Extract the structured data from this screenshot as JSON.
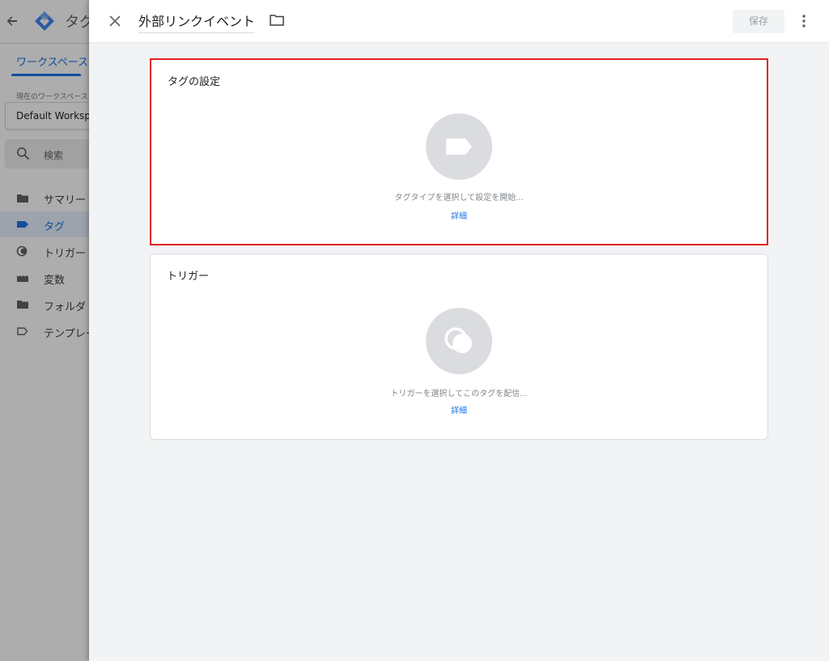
{
  "background": {
    "title": "タグ",
    "workspace_tab": "ワークスペース",
    "workspace_label": "現在のワークスペース",
    "workspace_name": "Default Workspace",
    "search_placeholder": "検索",
    "nav": [
      {
        "label": "サマリー",
        "icon": "summary-icon"
      },
      {
        "label": "タグ",
        "icon": "tag-icon"
      },
      {
        "label": "トリガー",
        "icon": "trigger-icon"
      },
      {
        "label": "変数",
        "icon": "variables-icon"
      },
      {
        "label": "フォルダ",
        "icon": "folder-icon"
      },
      {
        "label": "テンプレート",
        "icon": "template-icon"
      }
    ],
    "active_nav": "タグ"
  },
  "panel": {
    "tag_name": "外部リンクイベント",
    "save_label": "保存"
  },
  "tag_config": {
    "title": "タグの設定",
    "hint": "タグタイプを選択して設定を開始...",
    "details": "詳細"
  },
  "trigger": {
    "title": "トリガー",
    "hint": "トリガーを選択してこのタグを配信...",
    "details": "詳細"
  },
  "colors": {
    "accent": "#1a73e8",
    "highlight_border": "#e32222",
    "placeholder": "#dadce0",
    "panel_bg": "#f1f3f4"
  }
}
